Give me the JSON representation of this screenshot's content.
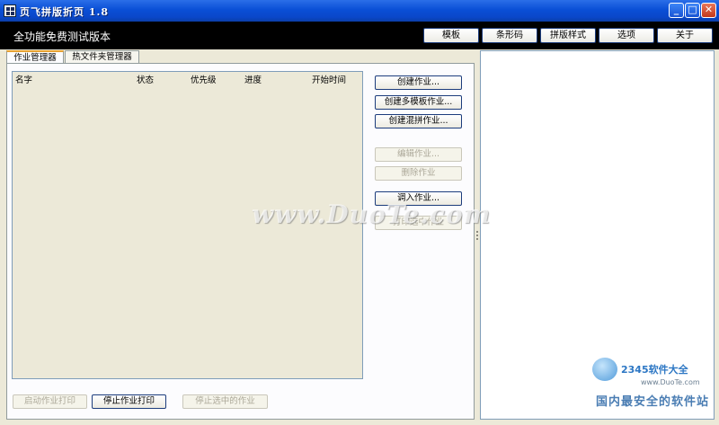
{
  "window": {
    "title": "页飞拼版折页 1.8",
    "controls": [
      "_",
      "□",
      "✕"
    ]
  },
  "header": {
    "edition": "全功能免费测试版本",
    "buttons": [
      "模板",
      "条形码",
      "拼版样式",
      "选项",
      "关于"
    ]
  },
  "tabs": [
    "作业管理器",
    "热文件夹管理器"
  ],
  "joblist": {
    "columns": [
      "名字",
      "状态",
      "优先级",
      "进度",
      "开始时间"
    ],
    "rows": []
  },
  "actions": {
    "create_job": "创建作业...",
    "create_multi_template": "创建多模板作业...",
    "create_mixed": "创建混拼作业...",
    "edit_job": "编辑作业...",
    "delete_job": "删除作业",
    "import_job": "调入作业...",
    "print_selected": "打印选中作业"
  },
  "bottom": {
    "start_print": "启动作业打印",
    "stop_print": "停止作业打印",
    "stop_selected": "停止选中的作业"
  },
  "watermark": "www.DuoTe.com",
  "corner_logo": {
    "name": "2345软件大全",
    "url": "www.DuoTe.com",
    "slogan": "国内最安全的软件站"
  }
}
